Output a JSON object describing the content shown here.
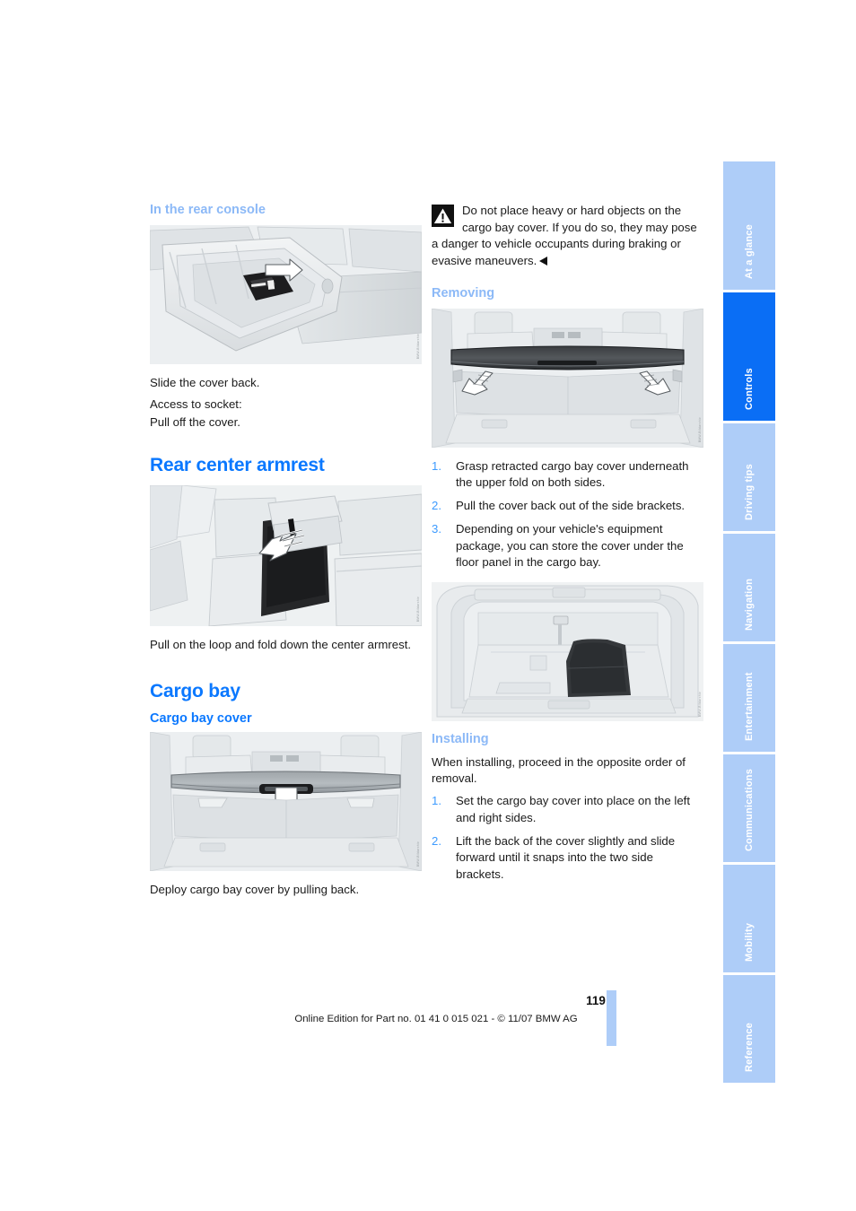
{
  "document": {
    "page_number": "119",
    "footer_text": "Online Edition for Part no. 01 41 0 015 021 - © 11/07 BMW AG"
  },
  "left_column": {
    "heading_rear_console": "In the rear console",
    "figure_rear_console_credit": "BMW-Bildarchiv",
    "caption_slide": "Slide the cover back.",
    "caption_access_1": "Access to socket:",
    "caption_access_2": "Pull off the cover.",
    "heading_rear_center_armrest": "Rear center armrest",
    "figure_armrest_credit": "BMW-Bildarchiv",
    "caption_armrest": "Pull on the loop and fold down the center armrest.",
    "heading_cargo_bay": "Cargo bay",
    "heading_cargo_bay_cover": "Cargo bay cover",
    "figure_cargo_cover_credit": "BMW-Bildarchiv",
    "caption_deploy": "Deploy cargo bay cover by pulling back."
  },
  "right_column": {
    "warning_icon": "warning-triangle-icon",
    "warning_text": "Do not place heavy or hard objects on the cargo bay cover. If you do so, they may pose a danger to vehicle occupants during braking or evasive maneuvers.",
    "heading_removing": "Removing",
    "figure_removing_credit": "BMW-Bildarchiv",
    "removing_steps": [
      "Grasp retracted cargo bay cover underneath the upper fold on both sides.",
      "Pull the cover back out of the side brackets.",
      "Depending on your vehicle's equipment package, you can store the cover under the floor panel in the cargo bay."
    ],
    "figure_storage_credit": "BMW-Bildarchiv",
    "heading_installing": "Installing",
    "installing_intro": "When installing, proceed in the opposite order of removal.",
    "installing_steps": [
      "Set the cargo bay cover into place on the left and right sides.",
      "Lift the back of the cover slightly and slide forward until it snaps into the two side brackets."
    ]
  },
  "sidebar": {
    "tabs": [
      {
        "label": "At a glance",
        "active": false
      },
      {
        "label": "Controls",
        "active": true
      },
      {
        "label": "Driving tips",
        "active": false
      },
      {
        "label": "Navigation",
        "active": false
      },
      {
        "label": "Entertainment",
        "active": false
      },
      {
        "label": "Communications",
        "active": false
      },
      {
        "label": "Mobility",
        "active": false
      },
      {
        "label": "Reference",
        "active": false
      }
    ]
  },
  "colors": {
    "heading_primary": "#0a78ff",
    "heading_secondary": "#8cb9f7",
    "tab_inactive": "#aecdf8",
    "tab_active": "#0a6ef5",
    "text": "#1a1a1a"
  }
}
